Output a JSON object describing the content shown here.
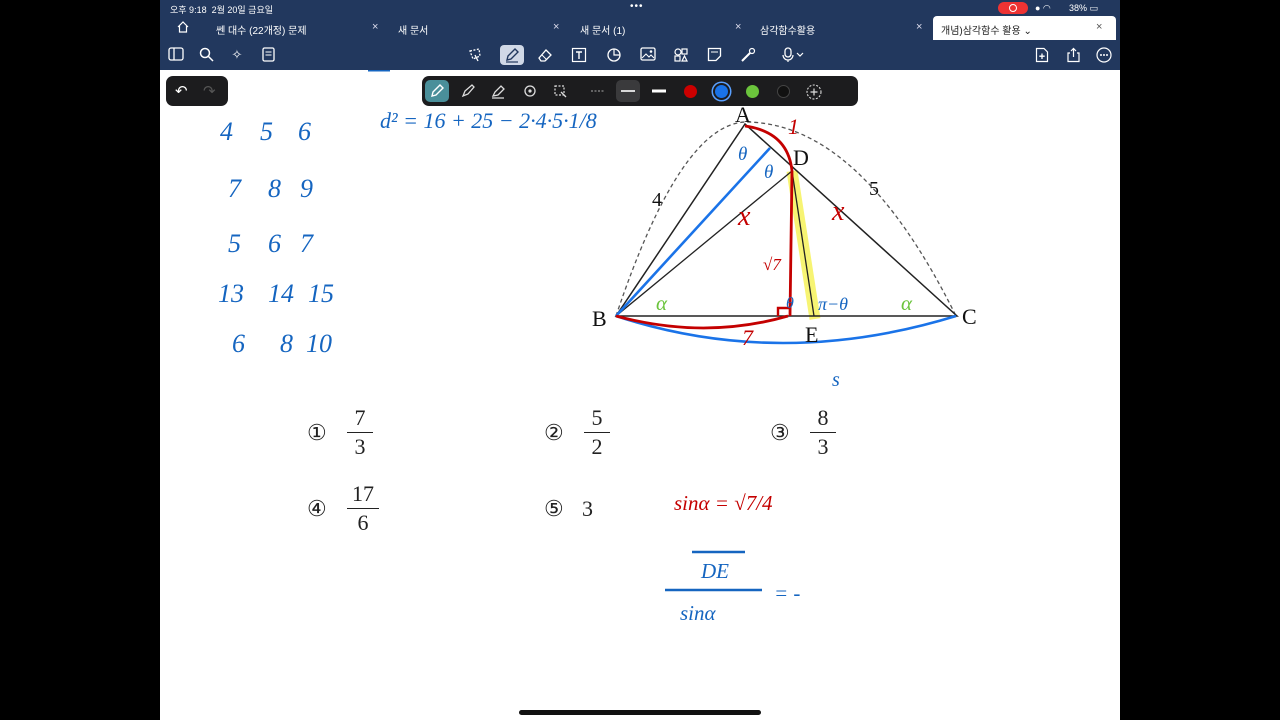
{
  "status_bar": {
    "time": "오후 9:18",
    "date": "2월 20일 금요일",
    "battery": "38%"
  },
  "tabs": [
    {
      "label": "쎈 대수 (22개정) 문제",
      "active": false
    },
    {
      "label": "새 문서",
      "active": false
    },
    {
      "label": "새 문서 (1)",
      "active": false
    },
    {
      "label": "삼각함수활용",
      "active": false
    },
    {
      "label": "개념)삼각함수 활용",
      "active": true
    }
  ],
  "toolbar": {
    "left_icons": [
      "sidebar-icon",
      "search-icon",
      "sparkle-icon",
      "document-icon"
    ],
    "center_icons": [
      "lasso-icon",
      "pen-icon",
      "eraser-icon",
      "text-box-icon",
      "shapes-icon",
      "image-icon",
      "elements-icon",
      "sticky-note-icon",
      "laser-pointer-icon",
      "microphone-icon"
    ],
    "right_icons": [
      "add-page-icon",
      "share-icon",
      "more-icon"
    ]
  },
  "pen_toolbar": {
    "colors": [
      "#cc0000",
      "#1a73e8",
      "#6bc43c",
      "#111111"
    ],
    "selected_color": "#1a73e8"
  },
  "figure": {
    "labels": {
      "A": "A",
      "B": "B",
      "C": "C",
      "D": "D",
      "E": "E"
    },
    "side_AB": "4",
    "side_AC": "5"
  },
  "choices": [
    {
      "mark": "①",
      "numerator": "7",
      "denominator": "3"
    },
    {
      "mark": "②",
      "numerator": "5",
      "denominator": "2"
    },
    {
      "mark": "③",
      "numerator": "8",
      "denominator": "3"
    },
    {
      "mark": "④",
      "numerator": "17",
      "denominator": "6"
    },
    {
      "mark": "⑤",
      "value": "3"
    }
  ],
  "handwriting": {
    "number_rows": [
      [
        "4",
        "5",
        "6"
      ],
      [
        "7",
        "8",
        "9"
      ],
      [
        "5",
        "6",
        "7"
      ],
      [
        "13",
        "14",
        "15"
      ],
      [
        "6",
        "8",
        "10"
      ]
    ],
    "equation_top": "d² = 16 + 25 − 2·4·5·1/8",
    "sin_alpha": "sinα = √7/4",
    "fraction_numerator": "DE",
    "fraction_denominator": "sinα",
    "equals": "= -",
    "angle_labels": {
      "theta": "θ",
      "alpha": "α",
      "pi_minus_theta": "π−θ",
      "alpha_2": "α"
    },
    "segment_labels": {
      "x1": "x",
      "x2": "x",
      "root7": "√7",
      "seven": "7",
      "one": "1",
      "s": "s"
    }
  }
}
